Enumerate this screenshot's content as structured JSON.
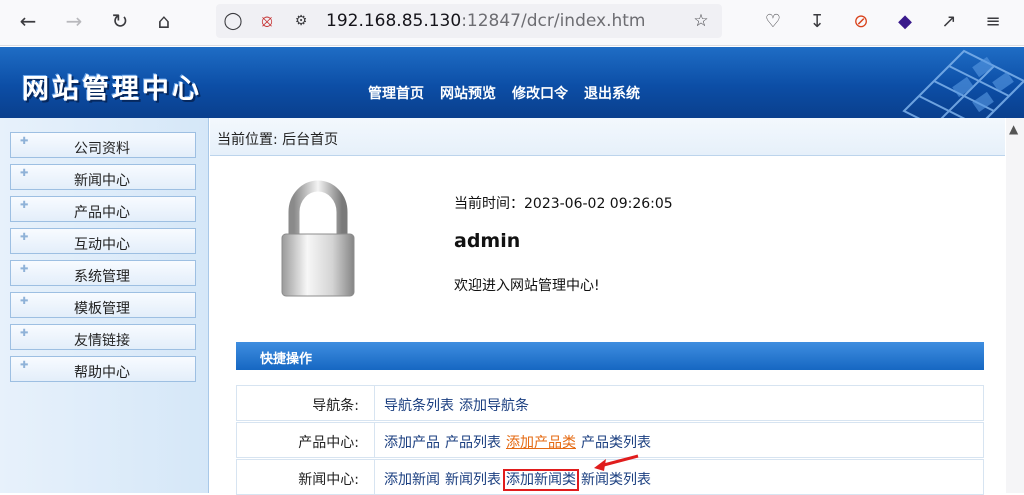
{
  "browser": {
    "url_host": "192.168.85.130",
    "url_rest": ":12847/dcr/index.htm"
  },
  "site": {
    "logo": "网站管理中心",
    "top_nav": [
      "管理首页",
      "网站预览",
      "修改口令",
      "退出系统"
    ]
  },
  "sidebar": {
    "items": [
      "公司资料",
      "新闻中心",
      "产品中心",
      "互动中心",
      "系统管理",
      "模板管理",
      "友情链接",
      "帮助中心"
    ]
  },
  "main": {
    "breadcrumb": "当前位置: 后台首页",
    "time_label": "当前时间：2023-06-02 09:26:05",
    "username": "admin",
    "welcome": "欢迎进入网站管理中心!",
    "quick_title": "快捷操作",
    "quick_rows": [
      {
        "label": "导航条:",
        "links": [
          "导航条列表",
          "添加导航条"
        ]
      },
      {
        "label": "产品中心:",
        "links": [
          "添加产品",
          "产品列表",
          "添加产品类",
          "产品类列表"
        ]
      },
      {
        "label": "新闻中心:",
        "links": [
          "添加新闻",
          "新闻列表",
          "添加新闻类",
          "新闻类列表"
        ]
      }
    ]
  },
  "colors": {
    "header_blue": "#0c4ea6",
    "link_blue": "#1b3f80",
    "link_hover": "#e56a12",
    "highlight_red": "#e01d1d"
  }
}
